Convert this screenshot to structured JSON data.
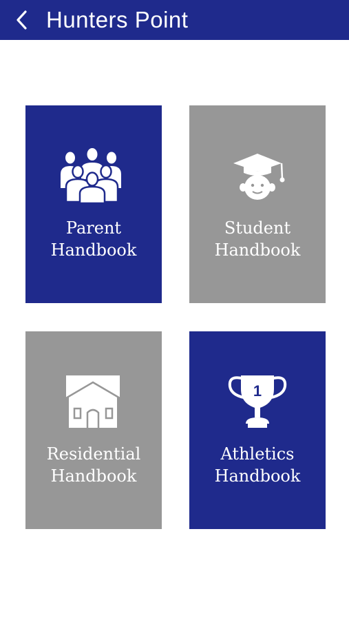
{
  "header": {
    "title": "Hunters Point",
    "back_icon": "chevron-left-icon"
  },
  "colors": {
    "brand_blue": "#1f2a8c",
    "tile_gray": "#979797",
    "text": "#ffffff"
  },
  "tiles": [
    {
      "line1": "Parent",
      "line2": "Handbook",
      "icon": "parents-group-icon",
      "color": "blue"
    },
    {
      "line1": "Student",
      "line2": "Handbook",
      "icon": "graduate-cap-icon",
      "color": "gray"
    },
    {
      "line1": "Residential",
      "line2": "Handbook",
      "icon": "house-icon",
      "color": "gray"
    },
    {
      "line1": "Athletics",
      "line2": "Handbook",
      "icon": "trophy-icon",
      "color": "blue",
      "trophy_number": "1"
    }
  ]
}
